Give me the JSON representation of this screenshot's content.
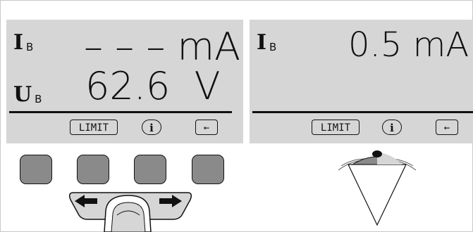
{
  "left_display": {
    "current_symbol": "I",
    "current_subscript": "B",
    "current_reading": "– – – mA",
    "voltage_symbol": "U",
    "voltage_subscript": "B",
    "voltage_reading": "62.6  V",
    "softkeys": [
      "LIMIT",
      "i",
      "←"
    ]
  },
  "right_display": {
    "current_symbol": "I",
    "current_subscript": "B",
    "current_reading": "0.5 mA",
    "softkeys": [
      "LIMIT",
      "i",
      "←"
    ]
  },
  "keypad": {
    "key_count": 4,
    "rocker_left_icon": "arrow-left-icon",
    "rocker_right_icon": "arrow-right-icon"
  },
  "probe": {
    "icon": "probe-contact-icon"
  },
  "colors": {
    "lcd_background": "#d6d6d6",
    "key_fill": "#8a8a8a",
    "ink": "#111111"
  }
}
